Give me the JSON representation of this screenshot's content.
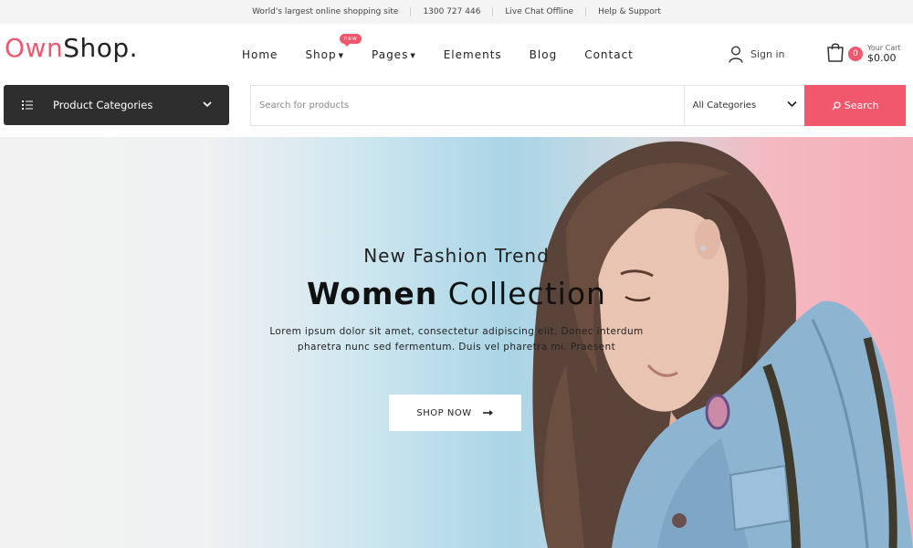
{
  "topbar": {
    "items": [
      "World's largest online shopping site",
      "1300 727 446",
      "Live Chat Offline",
      "Help & Support"
    ]
  },
  "logo": {
    "part1": "Own",
    "part2": "Shop."
  },
  "nav": {
    "items": [
      {
        "label": "Home"
      },
      {
        "label": "Shop",
        "badge": "new"
      },
      {
        "label": "Pages"
      },
      {
        "label": "Elements"
      },
      {
        "label": "Blog"
      },
      {
        "label": "Contact"
      }
    ]
  },
  "account": {
    "signin_label": "Sign in"
  },
  "cart": {
    "count": "0",
    "label": "Your Cart",
    "amount": "$0.00"
  },
  "categories": {
    "label": "Product Categories"
  },
  "search": {
    "placeholder": "Search for products",
    "category_selected": "All Categories",
    "button_label": "Search"
  },
  "hero": {
    "kicker": "New Fashion Trend",
    "title_bold": "Women",
    "title_light": "Collection",
    "description_line1": "Lorem ipsum dolor sit amet, consectetur adipiscing elit. Donec interdum",
    "description_line2": "pharetra nunc sed fermentum. Duis vel pharetra mi. Praesent",
    "cta_label": "SHOP NOW"
  },
  "colors": {
    "accent": "#f1576d",
    "dark": "#2e2e2e",
    "topbar_bg": "#f4f4f4"
  },
  "icons": [
    "user-icon",
    "shopping-bag-icon",
    "list-icon",
    "chevron-down-icon",
    "search-icon",
    "arrow-right-icon"
  ]
}
